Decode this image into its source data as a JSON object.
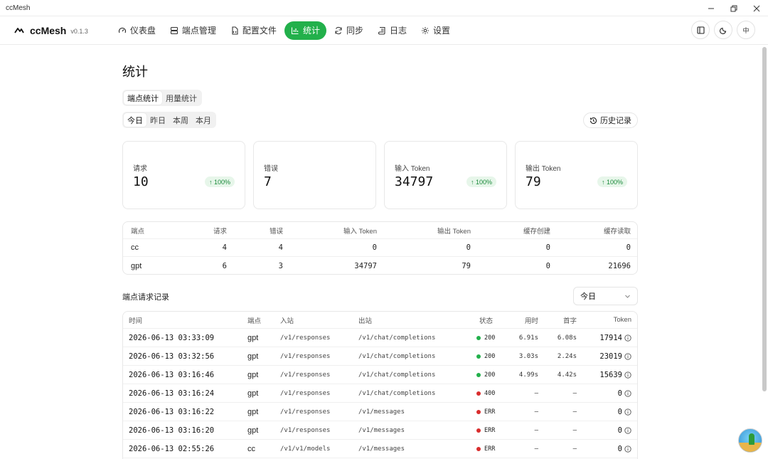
{
  "window": {
    "title": "ccMesh",
    "controls": [
      "minimize",
      "restore",
      "close"
    ]
  },
  "brand": {
    "name": "ccMesh",
    "version": "v0.1.3"
  },
  "nav": {
    "items": [
      {
        "label": "仪表盘",
        "icon": "gauge-icon",
        "active": false
      },
      {
        "label": "端点管理",
        "icon": "server-icon",
        "active": false
      },
      {
        "label": "配置文件",
        "icon": "file-code-icon",
        "active": false
      },
      {
        "label": "统计",
        "icon": "bar-chart-icon",
        "active": true
      },
      {
        "label": "同步",
        "icon": "refresh-icon",
        "active": false
      },
      {
        "label": "日志",
        "icon": "scroll-icon",
        "active": false
      },
      {
        "label": "设置",
        "icon": "gear-icon",
        "active": false
      }
    ],
    "lang_label": "中"
  },
  "page": {
    "title": "统计",
    "view_tabs": [
      {
        "label": "端点统计",
        "active": true
      },
      {
        "label": "用量统计",
        "active": false
      }
    ],
    "period_tabs": [
      {
        "label": "今日",
        "active": true
      },
      {
        "label": "昨日",
        "active": false
      },
      {
        "label": "本周",
        "active": false
      },
      {
        "label": "本月",
        "active": false
      }
    ],
    "history_label": "历史记录"
  },
  "cards": [
    {
      "label": "请求",
      "value": "10",
      "badge": "100%"
    },
    {
      "label": "错误",
      "value": "7",
      "badge": ""
    },
    {
      "label": "输入 Token",
      "value": "34797",
      "badge": "100%"
    },
    {
      "label": "输出 Token",
      "value": "79",
      "badge": "100%"
    }
  ],
  "endpoint_table": {
    "headers": [
      "端点",
      "请求",
      "错误",
      "输入 Token",
      "输出 Token",
      "缓存创建",
      "缓存读取"
    ],
    "rows": [
      [
        "cc",
        "4",
        "4",
        "0",
        "0",
        "0",
        "0"
      ],
      [
        "gpt",
        "6",
        "3",
        "34797",
        "79",
        "0",
        "21696"
      ]
    ]
  },
  "log_section": {
    "title": "端点请求记录",
    "filter_value": "今日"
  },
  "log_table": {
    "headers": [
      "时间",
      "端点",
      "入站",
      "出站",
      "状态",
      "用时",
      "首字",
      "Token"
    ],
    "rows": [
      [
        "2026-06-13 03:33:09",
        "gpt",
        "/v1/responses",
        "/v1/chat/completions",
        "200",
        "6.91s",
        "6.08s",
        "17914"
      ],
      [
        "2026-06-13 03:32:56",
        "gpt",
        "/v1/responses",
        "/v1/chat/completions",
        "200",
        "3.03s",
        "2.24s",
        "23019"
      ],
      [
        "2026-06-13 03:16:46",
        "gpt",
        "/v1/responses",
        "/v1/chat/completions",
        "200",
        "4.99s",
        "4.42s",
        "15639"
      ],
      [
        "2026-06-13 03:16:24",
        "gpt",
        "/v1/responses",
        "/v1/chat/completions",
        "400",
        "—",
        "—",
        "0"
      ],
      [
        "2026-06-13 03:16:22",
        "gpt",
        "/v1/responses",
        "/v1/messages",
        "ERR",
        "—",
        "—",
        "0"
      ],
      [
        "2026-06-13 03:16:20",
        "gpt",
        "/v1/responses",
        "/v1/messages",
        "ERR",
        "—",
        "—",
        "0"
      ],
      [
        "2026-06-13 02:55:26",
        "cc",
        "/v1/v1/models",
        "/v1/messages",
        "ERR",
        "—",
        "—",
        "0"
      ]
    ]
  },
  "colors": {
    "accent": "#22b04b",
    "ok": "#22b04b",
    "error": "#d92d2d",
    "badge_bg": "#e7f6ea"
  }
}
